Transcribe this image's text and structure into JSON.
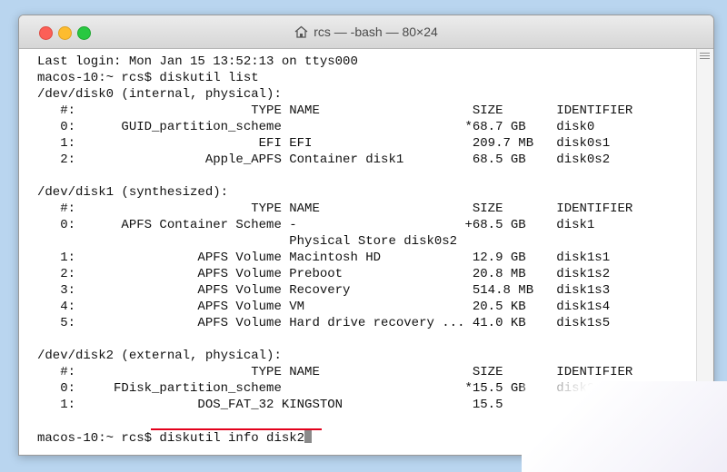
{
  "window": {
    "title": "rcs — -bash — 80×24",
    "close_label": "",
    "minimize_label": "",
    "zoom_label": ""
  },
  "terminal": {
    "lines": [
      "Last login: Mon Jan 15 13:52:13 on ttys000",
      "macos-10:~ rcs$ diskutil list",
      "/dev/disk0 (internal, physical):",
      "   #:                       TYPE NAME                    SIZE       IDENTIFIER",
      "   0:      GUID_partition_scheme                        *68.7 GB    disk0",
      "   1:                        EFI EFI                     209.7 MB   disk0s1",
      "   2:                 Apple_APFS Container disk1         68.5 GB    disk0s2",
      "",
      "/dev/disk1 (synthesized):",
      "   #:                       TYPE NAME                    SIZE       IDENTIFIER",
      "   0:      APFS Container Scheme -                      +68.5 GB    disk1",
      "                                 Physical Store disk0s2",
      "   1:                APFS Volume Macintosh HD            12.9 GB    disk1s1",
      "   2:                APFS Volume Preboot                 20.8 MB    disk1s2",
      "   3:                APFS Volume Recovery                514.8 MB   disk1s3",
      "   4:                APFS Volume VM                      20.5 KB    disk1s4",
      "   5:                APFS Volume Hard drive recovery ... 41.0 KB    disk1s5",
      "",
      "/dev/disk2 (external, physical):",
      "   #:                       TYPE NAME                    SIZE       IDENTIFIER",
      "   0:     FDisk_partition_scheme                        *15.5 GB    disk2",
      "   1:                DOS_FAT_32 KINGSTON                 15.5",
      ""
    ],
    "prompt": "macos-10:~ rcs$ ",
    "command": "diskutil info disk2"
  }
}
